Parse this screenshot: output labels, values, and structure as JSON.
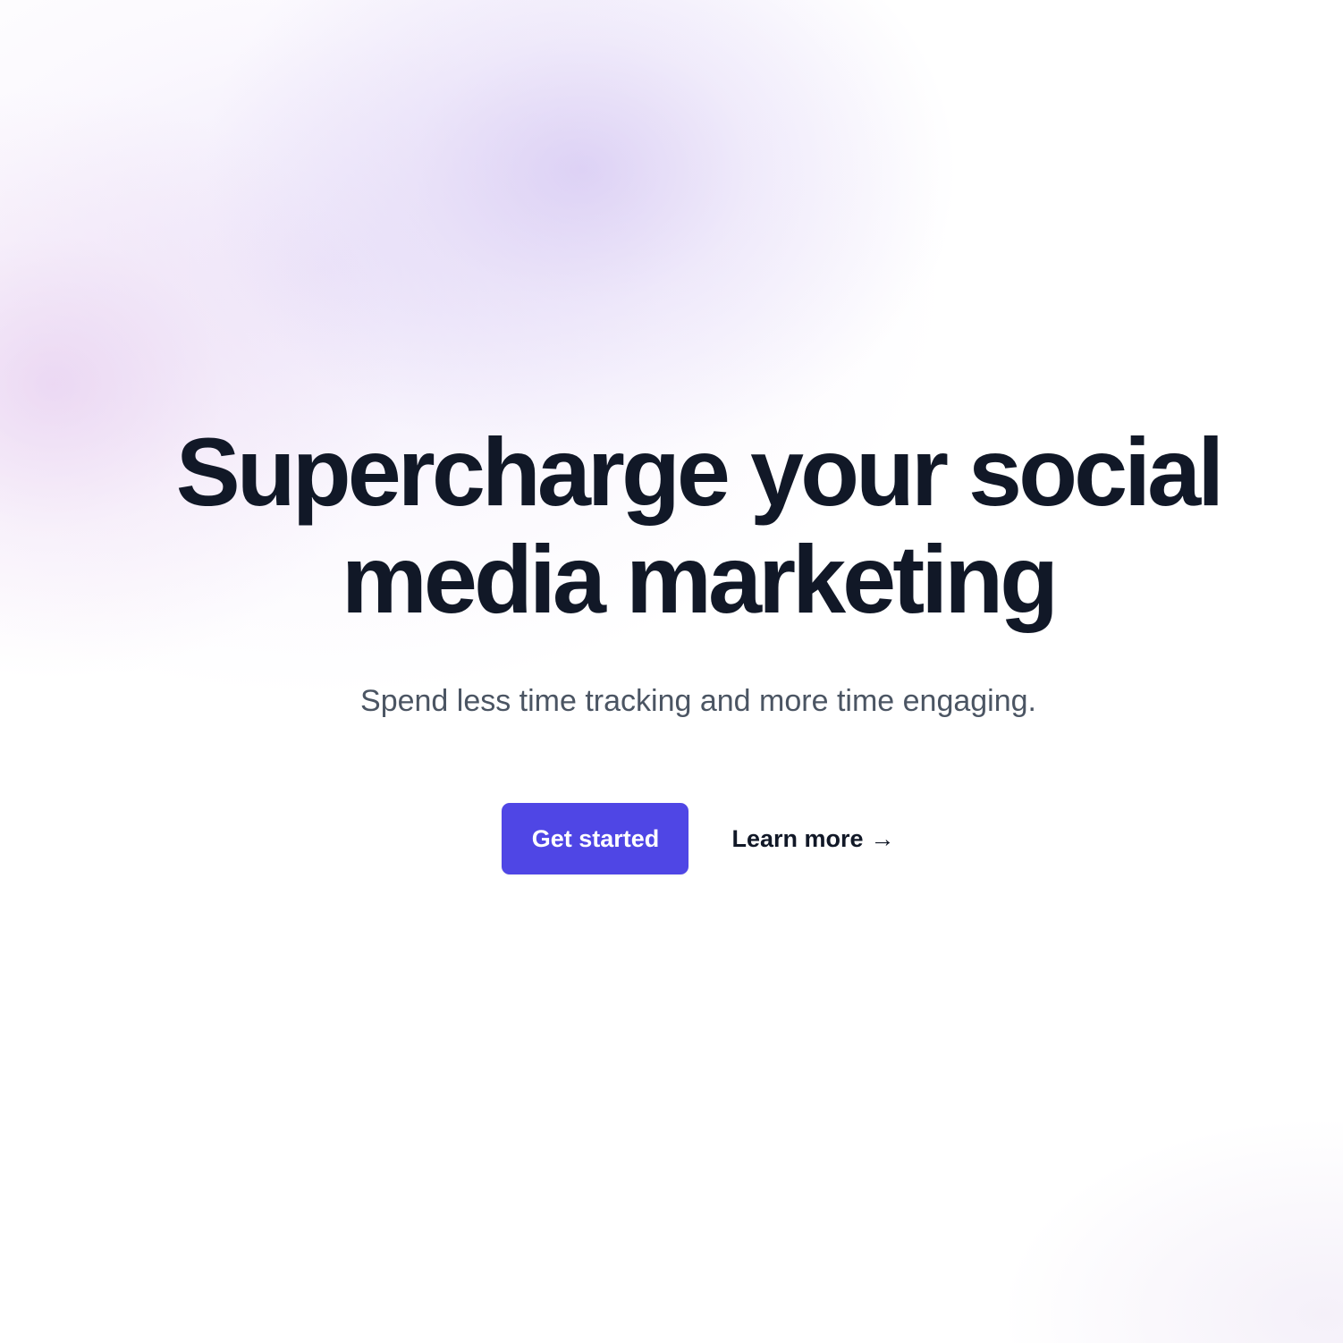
{
  "hero": {
    "headline_line1": "Supercharge your social",
    "headline_line2": "media marketing",
    "subtitle": "Spend less time tracking and more time engaging.",
    "primary_cta": "Get started",
    "secondary_cta": "Learn more",
    "secondary_cta_icon": "arrow-right-icon"
  },
  "colors": {
    "primary": "#4f46e5",
    "heading": "#111827",
    "subtitle": "#4b5563",
    "background": "#ffffff"
  }
}
